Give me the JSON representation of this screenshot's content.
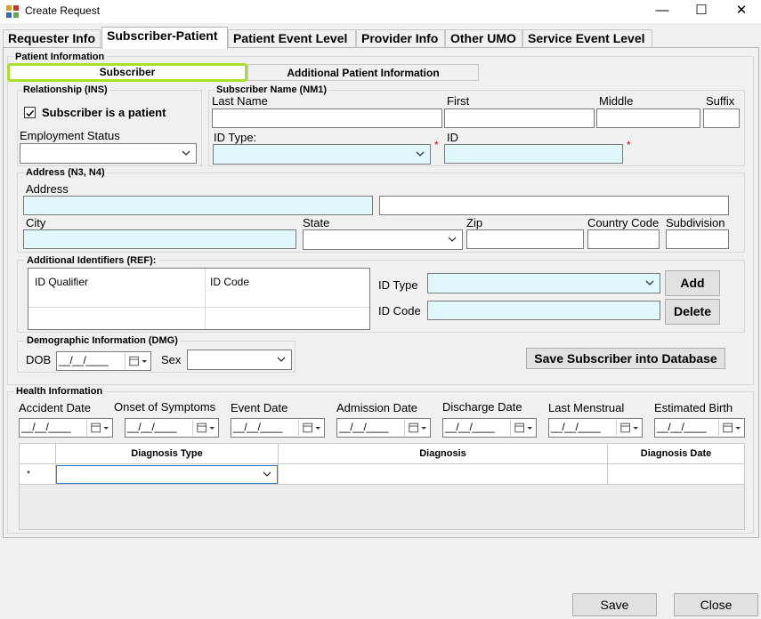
{
  "window": {
    "title": "Create Request",
    "minimize": "—",
    "maximize": "☐",
    "close": "✕"
  },
  "tabs": [
    "Requester Info",
    "Subscriber-Patient",
    "Patient Event Level",
    "Provider Info",
    "Other UMO",
    "Service Event Level"
  ],
  "patient_info": {
    "group_label": "Patient Information",
    "subtabs": [
      "Subscriber",
      "Additional Patient Information"
    ],
    "relationship": {
      "group_label": "Relationship (INS)",
      "checkbox_label": "Subscriber is a patient",
      "checked": true,
      "employment_label": "Employment Status",
      "employment_value": ""
    },
    "subscriber_name": {
      "group_label": "Subscriber Name (NM1)",
      "last_name_label": "Last Name",
      "first_label": "First",
      "middle_label": "Middle",
      "suffix_label": "Suffix",
      "id_type_label": "ID Type:",
      "id_label": "ID",
      "required_mark": "*"
    },
    "address": {
      "group_label": "Address (N3, N4)",
      "address_label": "Address",
      "city_label": "City",
      "state_label": "State",
      "zip_label": "Zip",
      "country_label": "Country Code",
      "subdivision_label": "Subdivision"
    },
    "identifiers": {
      "group_label": "Additional Identifiers (REF):",
      "columns": [
        "ID Qualifier",
        "ID Code"
      ],
      "id_type_label": "ID Type",
      "id_code_label": "ID Code",
      "add_label": "Add",
      "delete_label": "Delete"
    },
    "demographic": {
      "group_label": "Demographic Information (DMG)",
      "dob_label": "DOB",
      "dob_mask": "__/__/____",
      "sex_label": "Sex"
    },
    "save_db_label": "Save Subscriber into Database"
  },
  "health": {
    "group_label": "Health Information",
    "date_fields": [
      "Accident Date",
      "Onset of Symptoms",
      "Event Date",
      "Admission Date",
      "Discharge Date",
      "Last Menstrual",
      "Estimated Birth"
    ],
    "date_mask": "__/__/____",
    "grid_columns": [
      "Diagnosis Type",
      "Diagnosis",
      "Diagnosis Date"
    ],
    "new_row_marker": "*"
  },
  "footer": {
    "save_label": "Save",
    "close_label": "Close"
  },
  "colors": {
    "required_field": "#e0f8fb",
    "highlight_ring": "#a8e02c",
    "required_star": "#d00000"
  }
}
